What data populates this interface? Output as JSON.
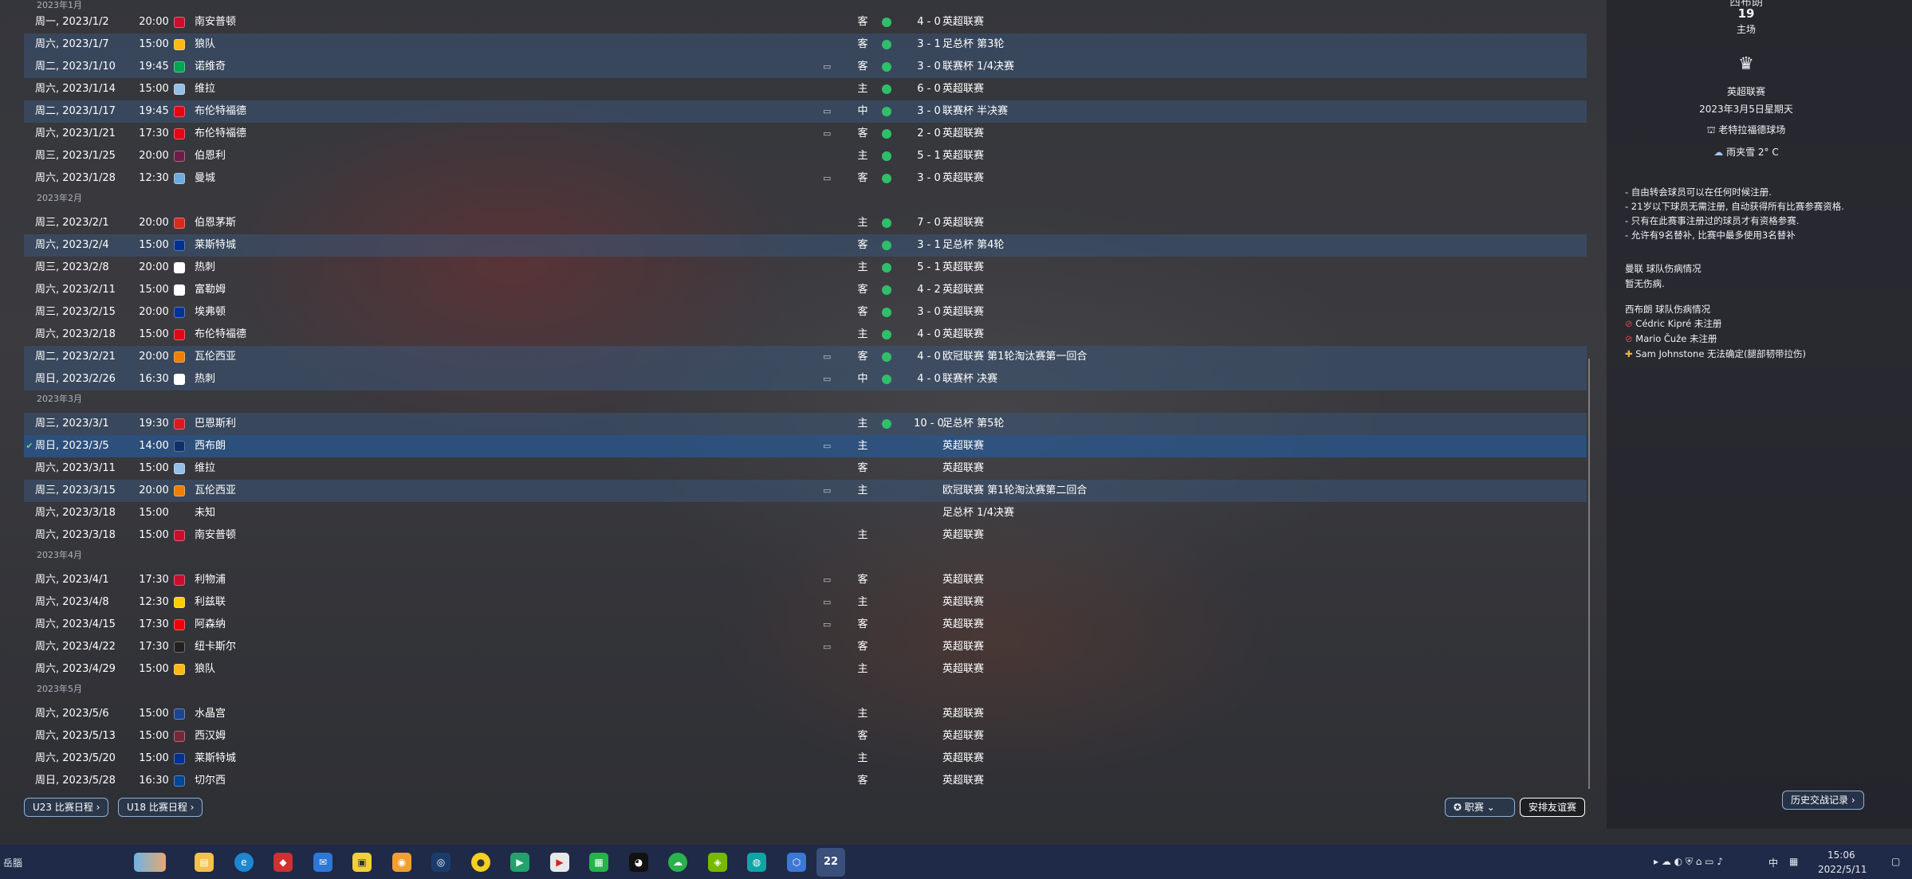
{
  "months": {
    "jan": "2023年1月",
    "feb": "2023年2月",
    "mar": "2023年3月",
    "apr": "2023年4月",
    "may": "2023年5月"
  },
  "fixtures": [
    {
      "date": "周一, 2023/1/2",
      "time": "20:00",
      "opponent": "南安普顿",
      "logo_color": "#c8102e",
      "tv": "",
      "venue": "客",
      "result_dot": true,
      "score": "4 - 0",
      "competition": "英超联赛"
    },
    {
      "date": "周六, 2023/1/7",
      "time": "15:00",
      "opponent": "狼队",
      "logo_color": "#fdb913",
      "tv": "",
      "venue": "客",
      "result_dot": true,
      "score": "3 - 1",
      "competition": "足总杯 第3轮"
    },
    {
      "date": "周二, 2023/1/10",
      "time": "19:45",
      "opponent": "诺维奇",
      "logo_color": "#00a650",
      "tv": "▭",
      "venue": "客",
      "result_dot": true,
      "score": "3 - 0",
      "competition": "联赛杯 1/4决赛"
    },
    {
      "date": "周六, 2023/1/14",
      "time": "15:00",
      "opponent": "维拉",
      "logo_color": "#95bfe5",
      "tv": "",
      "venue": "主",
      "result_dot": true,
      "score": "6 - 0",
      "competition": "英超联赛"
    },
    {
      "date": "周二, 2023/1/17",
      "time": "19:45",
      "opponent": "布伦特福德",
      "logo_color": "#e30613",
      "tv": "▭",
      "venue": "中",
      "result_dot": true,
      "score": "3 - 0",
      "competition": "联赛杯 半决赛"
    },
    {
      "date": "周六, 2023/1/21",
      "time": "17:30",
      "opponent": "布伦特福德",
      "logo_color": "#e30613",
      "tv": "▭",
      "venue": "客",
      "result_dot": true,
      "score": "2 - 0",
      "competition": "英超联赛"
    },
    {
      "date": "周三, 2023/1/25",
      "time": "20:00",
      "opponent": "伯恩利",
      "logo_color": "#6c1d45",
      "tv": "",
      "venue": "主",
      "result_dot": true,
      "score": "5 - 1",
      "competition": "英超联赛"
    },
    {
      "date": "周六, 2023/1/28",
      "time": "12:30",
      "opponent": "曼城",
      "logo_color": "#6cabdd",
      "tv": "▭",
      "venue": "客",
      "result_dot": true,
      "score": "3 - 0",
      "competition": "英超联赛"
    },
    {
      "date": "周三, 2023/2/1",
      "time": "20:00",
      "opponent": "伯恩茅斯",
      "logo_color": "#da291c",
      "tv": "",
      "venue": "主",
      "result_dot": true,
      "score": "7 - 0",
      "competition": "英超联赛"
    },
    {
      "date": "周六, 2023/2/4",
      "time": "15:00",
      "opponent": "莱斯特城",
      "logo_color": "#003090",
      "tv": "",
      "venue": "客",
      "result_dot": true,
      "score": "3 - 1",
      "competition": "足总杯 第4轮"
    },
    {
      "date": "周三, 2023/2/8",
      "time": "20:00",
      "opponent": "热刺",
      "logo_color": "#ffffff",
      "tv": "",
      "venue": "主",
      "result_dot": true,
      "score": "5 - 1",
      "competition": "英超联赛"
    },
    {
      "date": "周六, 2023/2/11",
      "time": "15:00",
      "opponent": "富勒姆",
      "logo_color": "#ffffff",
      "tv": "",
      "venue": "客",
      "result_dot": true,
      "score": "4 - 2",
      "competition": "英超联赛"
    },
    {
      "date": "周三, 2023/2/15",
      "time": "20:00",
      "opponent": "埃弗顿",
      "logo_color": "#003399",
      "tv": "",
      "venue": "客",
      "result_dot": true,
      "score": "3 - 0",
      "competition": "英超联赛"
    },
    {
      "date": "周六, 2023/2/18",
      "time": "15:00",
      "opponent": "布伦特福德",
      "logo_color": "#e30613",
      "tv": "",
      "venue": "主",
      "result_dot": true,
      "score": "4 - 0",
      "competition": "英超联赛"
    },
    {
      "date": "周二, 2023/2/21",
      "time": "20:00",
      "opponent": "瓦伦西亚",
      "logo_color": "#ee7f00",
      "tv": "▭",
      "venue": "客",
      "result_dot": true,
      "score": "4 - 0",
      "competition": "欧冠联赛 第1轮淘汰赛第一回合"
    },
    {
      "date": "周日, 2023/2/26",
      "time": "16:30",
      "opponent": "热刺",
      "logo_color": "#ffffff",
      "tv": "▭",
      "venue": "中",
      "result_dot": true,
      "score": "4 - 0",
      "competition": "联赛杯 决赛"
    },
    {
      "date": "周三, 2023/3/1",
      "time": "19:30",
      "opponent": "巴恩斯利",
      "logo_color": "#d71920",
      "tv": "",
      "venue": "主",
      "result_dot": true,
      "score": "10 - 0",
      "competition": "足总杯 第5轮"
    },
    {
      "date": "周日, 2023/3/5",
      "time": "14:00",
      "opponent": "西布朗",
      "logo_color": "#122f67",
      "tv": "▭",
      "venue": "主",
      "result_dot": false,
      "score": "",
      "competition": "英超联赛",
      "check": "✔"
    },
    {
      "date": "周六, 2023/3/11",
      "time": "15:00",
      "opponent": "维拉",
      "logo_color": "#95bfe5",
      "tv": "",
      "venue": "客",
      "result_dot": false,
      "score": "",
      "competition": "英超联赛"
    },
    {
      "date": "周三, 2023/3/15",
      "time": "20:00",
      "opponent": "瓦伦西亚",
      "logo_color": "#ee7f00",
      "tv": "▭",
      "venue": "主",
      "result_dot": false,
      "score": "",
      "competition": "欧冠联赛 第1轮淘汰赛第二回合"
    },
    {
      "date": "周六, 2023/3/18",
      "time": "15:00",
      "opponent": "未知",
      "logo_color": "",
      "tv": "",
      "venue": "",
      "result_dot": false,
      "score": "",
      "competition": "足总杯 1/4决赛"
    },
    {
      "date": "周六, 2023/3/18",
      "time": "15:00",
      "opponent": "南安普顿",
      "logo_color": "#c8102e",
      "tv": "",
      "venue": "主",
      "result_dot": false,
      "score": "",
      "competition": "英超联赛"
    },
    {
      "date": "周六, 2023/4/1",
      "time": "17:30",
      "opponent": "利物浦",
      "logo_color": "#c8102e",
      "tv": "▭",
      "venue": "客",
      "result_dot": false,
      "score": "",
      "competition": "英超联赛"
    },
    {
      "date": "周六, 2023/4/8",
      "time": "12:30",
      "opponent": "利兹联",
      "logo_color": "#ffcd00",
      "tv": "▭",
      "venue": "主",
      "result_dot": false,
      "score": "",
      "competition": "英超联赛"
    },
    {
      "date": "周六, 2023/4/15",
      "time": "17:30",
      "opponent": "阿森纳",
      "logo_color": "#ef0107",
      "tv": "▭",
      "venue": "客",
      "result_dot": false,
      "score": "",
      "competition": "英超联赛"
    },
    {
      "date": "周六, 2023/4/22",
      "time": "17:30",
      "opponent": "纽卡斯尔",
      "logo_color": "#241f20",
      "tv": "▭",
      "venue": "客",
      "result_dot": false,
      "score": "",
      "competition": "英超联赛"
    },
    {
      "date": "周六, 2023/4/29",
      "time": "15:00",
      "opponent": "狼队",
      "logo_color": "#fdb913",
      "tv": "",
      "venue": "主",
      "result_dot": false,
      "score": "",
      "competition": "英超联赛"
    },
    {
      "date": "周六, 2023/5/6",
      "time": "15:00",
      "opponent": "水晶宫",
      "logo_color": "#1b458f",
      "tv": "",
      "venue": "主",
      "result_dot": false,
      "score": "",
      "competition": "英超联赛"
    },
    {
      "date": "周六, 2023/5/13",
      "time": "15:00",
      "opponent": "西汉姆",
      "logo_color": "#7a263a",
      "tv": "",
      "venue": "客",
      "result_dot": false,
      "score": "",
      "competition": "英超联赛"
    },
    {
      "date": "周六, 2023/5/20",
      "time": "15:00",
      "opponent": "莱斯特城",
      "logo_color": "#003090",
      "tv": "",
      "venue": "主",
      "result_dot": false,
      "score": "",
      "competition": "英超联赛"
    },
    {
      "date": "周日, 2023/5/28",
      "time": "16:30",
      "opponent": "切尔西",
      "logo_color": "#034694",
      "tv": "",
      "venue": "客",
      "result_dot": false,
      "score": "",
      "competition": "英超联赛"
    }
  ],
  "buttons": {
    "u23": "U23 比赛日程 ›",
    "u18": "U18 比赛日程 ›",
    "career": "职赛",
    "friendly": "安排友谊赛",
    "history": "历史交战记录 ›"
  },
  "panel": {
    "top_partial": "西布朗",
    "round": "19",
    "venue_label": "主场",
    "league": "英超联赛",
    "date": "2023年3月5日星期天",
    "stadium": "老特拉福德球场",
    "weather": "雨夹雪 2° C",
    "rules": [
      "- 自由转会球员可以在任何时候注册.",
      "- 21岁以下球员无需注册, 自动获得所有比赛参赛资格.",
      "- 只有在此赛事注册过的球员才有资格参赛.",
      "- 允许有9名替补, 比赛中最多使用3名替补"
    ],
    "own_injury_title": "曼联 球队伤病情况",
    "own_injury_text": "暂无伤病.",
    "opp_injury_title": "西布朗 球队伤病情况",
    "opp_injuries": [
      {
        "icon": "⃠",
        "color": "#e0474c",
        "text": "Cédric Kipré 未注册"
      },
      {
        "icon": "⃠",
        "color": "#e0474c",
        "text": "Mario Čuže 未注册"
      },
      {
        "icon": "✚",
        "color": "#f2b233",
        "text": "Sam Johnstone 无法确定(腿部韧带拉伤)"
      }
    ]
  },
  "taskbar": {
    "left_text": "岳腦",
    "app_badge": "22",
    "ime": "中",
    "time": "15:06",
    "date": "2022/5/11"
  }
}
